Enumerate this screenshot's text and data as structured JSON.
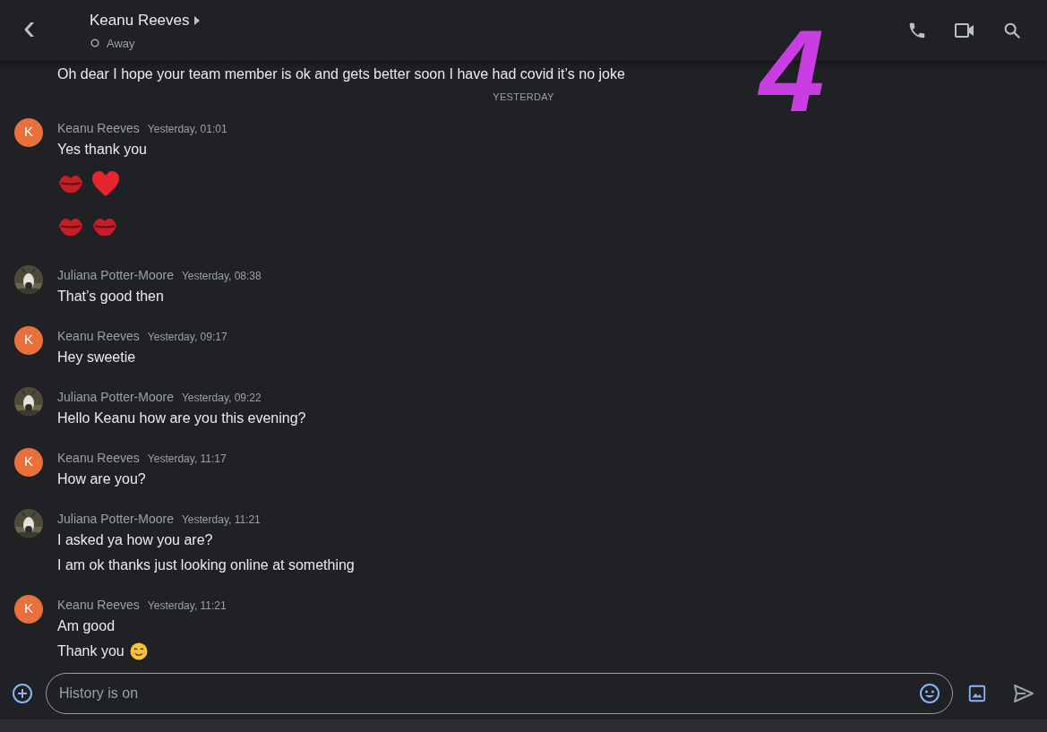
{
  "header": {
    "back": "‹",
    "title": "Keanu Reeves",
    "status": "Away"
  },
  "partial_message": "Oh dear I hope your team member is ok and gets better soon I have had covid it’s no joke",
  "date_divider": "YESTERDAY",
  "groups": [
    {
      "sender": "Keanu Reeves",
      "time": "Yesterday, 01:01",
      "avatar": {
        "kind": "letter",
        "letter": "K",
        "color": "#e8703a"
      },
      "messages": [
        {
          "kind": "text",
          "text": "Yes thank you"
        },
        {
          "kind": "emoji",
          "emojis": [
            {
              "kind": "kiss_mark"
            },
            {
              "kind": "red_heart"
            }
          ]
        },
        {
          "kind": "emoji",
          "emojis": [
            {
              "kind": "kiss_mark"
            },
            {
              "kind": "kiss_mark"
            }
          ]
        }
      ]
    },
    {
      "sender": "Juliana Potter-Moore",
      "time": "Yesterday, 08:38",
      "avatar": {
        "kind": "picture"
      },
      "messages": [
        {
          "kind": "text",
          "text": "That’s good then"
        }
      ]
    },
    {
      "sender": "Keanu Reeves",
      "time": "Yesterday, 09:17",
      "avatar": {
        "kind": "letter",
        "letter": "K",
        "color": "#e8703a"
      },
      "messages": [
        {
          "kind": "text",
          "text": "Hey sweetie"
        }
      ]
    },
    {
      "sender": "Juliana Potter-Moore",
      "time": "Yesterday, 09:22",
      "avatar": {
        "kind": "picture"
      },
      "messages": [
        {
          "kind": "text",
          "text": "Hello Keanu how are you this evening?"
        }
      ]
    },
    {
      "sender": "Keanu Reeves",
      "time": "Yesterday, 11:17",
      "avatar": {
        "kind": "letter",
        "letter": "K",
        "color": "#e8703a"
      },
      "messages": [
        {
          "kind": "text",
          "text": "How are you?"
        }
      ]
    },
    {
      "sender": "Juliana Potter-Moore",
      "time": "Yesterday, 11:21",
      "avatar": {
        "kind": "picture"
      },
      "messages": [
        {
          "kind": "text",
          "text": "I asked ya how you are?"
        },
        {
          "kind": "text",
          "text": "I am ok thanks just looking online at something"
        }
      ]
    },
    {
      "sender": "Keanu Reeves",
      "time": "Yesterday, 11:21",
      "avatar": {
        "kind": "letter",
        "letter": "K",
        "color": "#e8703a"
      },
      "messages": [
        {
          "kind": "text",
          "text": "Am good"
        },
        {
          "kind": "text",
          "text": "Thank you",
          "trailing_emoji": {
            "kind": "smiling_face"
          }
        }
      ]
    }
  ],
  "composer": {
    "placeholder": "History is on"
  },
  "annotation": {
    "text": "4",
    "color": "#c93de3"
  }
}
